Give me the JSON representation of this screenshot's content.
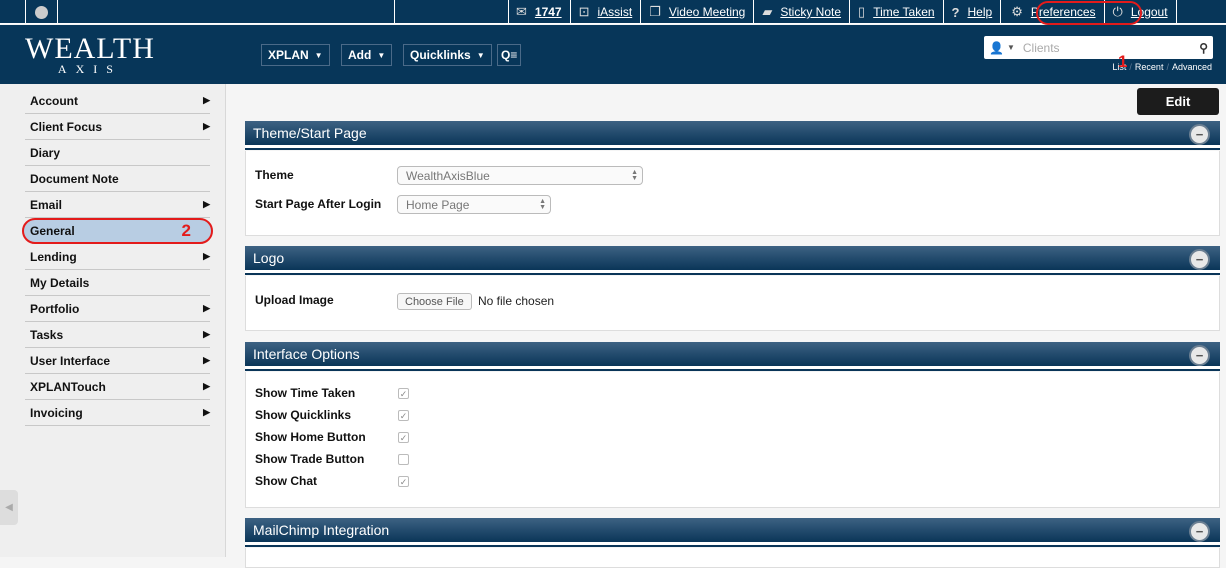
{
  "topbar": {
    "items": [
      {
        "icon": "mail-icon",
        "label": "1747"
      },
      {
        "icon": "iassist-icon",
        "label": "iAssist"
      },
      {
        "icon": "video-meeting-icon",
        "label": "Video Meeting"
      },
      {
        "icon": "sticky-note-icon",
        "label": "Sticky Note"
      },
      {
        "icon": "time-taken-icon",
        "label": "Time Taken"
      },
      {
        "icon": "help-icon",
        "label": "Help"
      },
      {
        "icon": "gear-icon",
        "label": "Preferences"
      },
      {
        "icon": "power-icon",
        "label": "Logout"
      }
    ],
    "annotation": "1"
  },
  "header": {
    "logo_top": "WEALTH",
    "logo_bottom": "AXIS",
    "nav": [
      "XPLAN",
      "Add",
      "Quicklinks"
    ],
    "search": {
      "placeholder": "Clients",
      "links": [
        "List",
        "Recent",
        "Advanced"
      ]
    }
  },
  "sidebar": {
    "items": [
      {
        "label": "Account",
        "arrow": true
      },
      {
        "label": "Client Focus",
        "arrow": true
      },
      {
        "label": "Diary",
        "arrow": false
      },
      {
        "label": "Document Note",
        "arrow": false
      },
      {
        "label": "Email",
        "arrow": true
      },
      {
        "label": "General",
        "arrow": false,
        "active": true
      },
      {
        "label": "Lending",
        "arrow": true
      },
      {
        "label": "My Details",
        "arrow": false
      },
      {
        "label": "Portfolio",
        "arrow": true
      },
      {
        "label": "Tasks",
        "arrow": true
      },
      {
        "label": "User Interface",
        "arrow": true
      },
      {
        "label": "XPLANTouch",
        "arrow": true
      },
      {
        "label": "Invoicing",
        "arrow": true
      }
    ],
    "annotation": "2"
  },
  "main": {
    "edit_label": "Edit",
    "theme_section": {
      "title": "Theme/Start Page",
      "theme_label": "Theme",
      "theme_value": "WealthAxisBlue",
      "start_label": "Start Page After Login",
      "start_value": "Home Page"
    },
    "logo_section": {
      "title": "Logo",
      "upload_label": "Upload Image",
      "choose_file": "Choose File",
      "no_file": "No file chosen"
    },
    "interface_section": {
      "title": "Interface Options",
      "options": [
        {
          "label": "Show Time Taken",
          "checked": true
        },
        {
          "label": "Show Quicklinks",
          "checked": true
        },
        {
          "label": "Show Home Button",
          "checked": true
        },
        {
          "label": "Show Trade Button",
          "checked": false
        },
        {
          "label": "Show Chat",
          "checked": true
        }
      ]
    },
    "mailchimp_section": {
      "title": "MailChimp Integration"
    }
  }
}
